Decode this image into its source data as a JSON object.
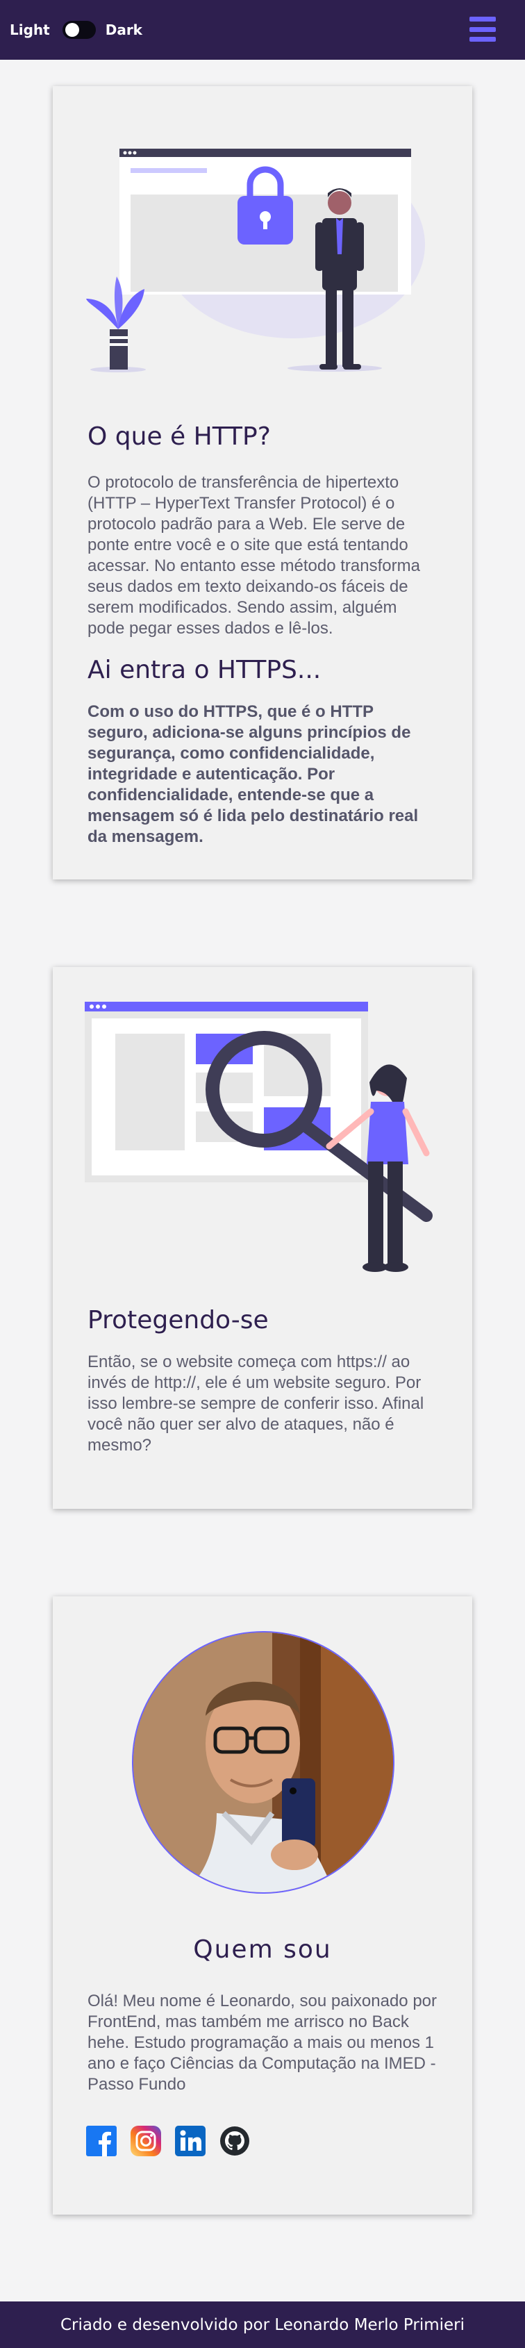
{
  "header": {
    "theme_light": "Light",
    "theme_dark": "Dark"
  },
  "colors": {
    "header_bg": "#2e1f4f",
    "accent": "#6c63ff",
    "page_bg": "#f4f4f5",
    "card_bg": "#f1f1f1",
    "heading": "#2e1f4f"
  },
  "sections": {
    "http": {
      "title": "O que é HTTP?",
      "body": "O protocolo de transferência de hipertexto (HTTP – HyperText Transfer Protocol) é o protocolo padrão para a Web. Ele serve de ponte entre você e o site que está tentando acessar. No entanto esse método transforma seus dados em texto deixando-os fáceis de serem modificados. Sendo assim, alguém pode pegar esses dados e lê-los.",
      "subtitle": "Ai entra o HTTPS...",
      "body2": "Com o uso do HTTPS, que é o HTTP seguro, adiciona-se alguns princípios de segurança, como confidencialidade, integridade e autenticação. Por confidencialidade, entende-se que a mensagem só é lida pelo destinatário real da mensagem."
    },
    "protect": {
      "title": "Protegendo-se",
      "body": "Então, se o website começa com https:// ao invés de http://, ele é um website seguro. Por isso lembre-se sempre de conferir isso. Afinal você não quer ser alvo de ataques, não é mesmo?"
    },
    "about": {
      "title": "Quem sou",
      "body": "Olá! Meu nome é Leonardo, sou paixonado por FrontEnd, mas também me arrisco no Back hehe. Estudo programação a mais ou menos 1 ano e faço Ciências da Computação na IMED - Passo Fundo"
    }
  },
  "social_icons": [
    "facebook-icon",
    "instagram-icon",
    "linkedin-icon",
    "github-icon"
  ],
  "footer": {
    "text": "Criado e desenvolvido por Leonardo Merlo Primieri"
  }
}
